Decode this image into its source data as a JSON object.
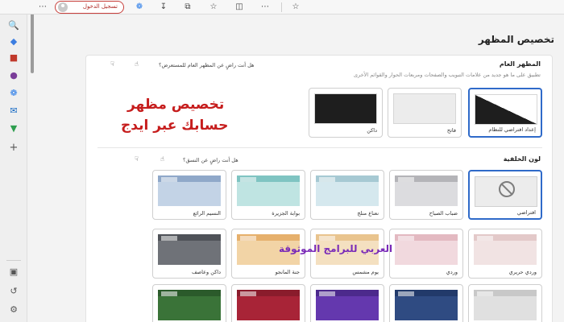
{
  "toolbar": {
    "signin_label": "تسجيل الدخول",
    "icons": [
      "more-icon",
      "copilot-icon",
      "download-icon",
      "collections-icon",
      "favorites-icon",
      "split-screen-icon",
      "star-icon"
    ]
  },
  "sidebar": {
    "logo_text": "b",
    "icons": [
      "search-icon",
      "tag-icon",
      "tools-icon",
      "people-icon",
      "copilot-icon",
      "outlook-icon",
      "shopping-icon",
      "add-icon",
      "sidebar-layout-icon",
      "history-icon",
      "settings-icon"
    ]
  },
  "page": {
    "title": "تخصيص المظهر"
  },
  "appearance": {
    "title": "المظهر العام",
    "subtitle": "تطبيق على ما هو جديد من علامات التبويب والصفحات ومربعات الحوار والقوائم الأخرى",
    "feedback": "هل أنت راضٍ عن المظهر العام للمستعرض؟",
    "themes": [
      {
        "label": "إعداد افتراضي للنظام",
        "selected": true
      },
      {
        "label": "فاتح",
        "selected": false
      },
      {
        "label": "داكن",
        "selected": false
      }
    ]
  },
  "colors": {
    "title": "لون الخلفية",
    "feedback": "هل أنت راضٍ عن النسق؟",
    "rows": [
      [
        {
          "label": "افتراضي",
          "selected": true,
          "bar": "#cfcfcf",
          "body": "#ececec",
          "default": true
        },
        {
          "label": "ضباب الصباح",
          "bar": "#b4b4b8",
          "body": "#dcdcdf"
        },
        {
          "label": "نعناع منلج",
          "bar": "#a6c9d3",
          "body": "#d5e8ee"
        },
        {
          "label": "بوابة الجزيرة",
          "bar": "#7fc4c2",
          "body": "#bfe4e2"
        },
        {
          "label": "النسيم الرائع",
          "bar": "#8fa8c9",
          "body": "#c3d3e6"
        }
      ],
      [
        {
          "label": "وردي حريري",
          "bar": "#e3c9c9",
          "body": "#f1e3e3"
        },
        {
          "label": "وردي",
          "bar": "#e3b9c1",
          "body": "#f1d9de"
        },
        {
          "label": "يوم مشمس",
          "bar": "#e9c48e",
          "body": "#f4e0c0"
        },
        {
          "label": "جنة المانجو",
          "bar": "#e6b06c",
          "body": "#f2d4a6"
        },
        {
          "label": "داكن وعاصف",
          "bar": "#4f5258",
          "body": "#6f7278"
        }
      ],
      [
        {
          "label": "",
          "bar": "#c8c8c8",
          "body": "#e0e0e0"
        },
        {
          "label": "",
          "bar": "#223a6a",
          "body": "#2f4b82"
        },
        {
          "label": "",
          "bar": "#4c2a8c",
          "body": "#6438ae"
        },
        {
          "label": "",
          "bar": "#8a1c2c",
          "body": "#a82437"
        },
        {
          "label": "",
          "bar": "#2b5a2b",
          "body": "#3a7338"
        }
      ]
    ]
  },
  "overlay": {
    "line1": "تخصيص مظهر",
    "line2": "حسابك عبر ايدج",
    "watermark": "العربي للبرامج الموثوقة"
  },
  "colors_palette": {
    "accent": "#2f6ac9",
    "signin_border": "#c8403c",
    "overlay_red": "#c61d1d",
    "overlay_purple": "#7a2bb8"
  }
}
